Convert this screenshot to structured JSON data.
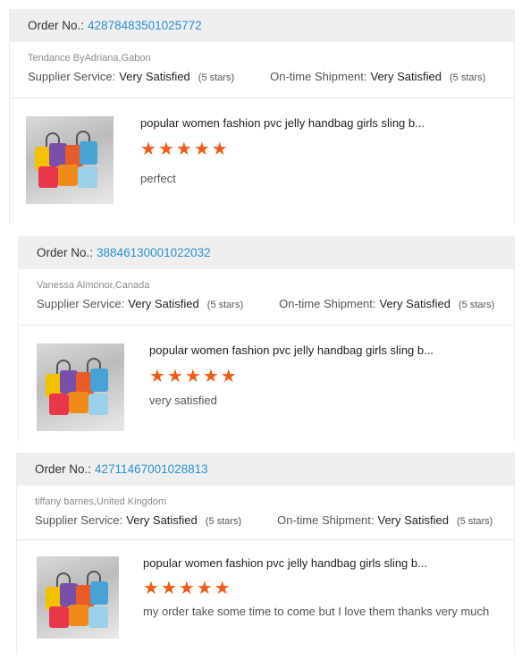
{
  "labels": {
    "order_prefix": "Order No.:",
    "supplier_service": "Supplier Service:",
    "on_time_shipment": "On-time Shipment:"
  },
  "reviews": [
    {
      "order_no": "42878483501025772",
      "buyer": "Tendance ByAdriana,Gabon",
      "supplier_value": "Very Satisfied",
      "supplier_stars": "(5 stars)",
      "shipment_value": "Very Satisfied",
      "shipment_stars": "(5 stars)",
      "product_title": "popular women fashion pvc jelly handbag girls sling b...",
      "rating": 5,
      "comment": "perfect"
    },
    {
      "order_no": "38846130001022032",
      "buyer": "Vanessa Almonor,Canada",
      "supplier_value": "Very Satisfied",
      "supplier_stars": "(5 stars)",
      "shipment_value": "Very Satisfied",
      "shipment_stars": "(5 stars)",
      "product_title": "popular women fashion pvc jelly handbag girls sling b...",
      "rating": 5,
      "comment": "very satisfied"
    },
    {
      "order_no": "42711467001028813",
      "buyer": "tiffany barnes,United Kingdom",
      "supplier_value": "Very Satisfied",
      "supplier_stars": "(5 stars)",
      "shipment_value": "Very Satisfied",
      "shipment_stars": "(5 stars)",
      "product_title": "popular women fashion pvc jelly handbag girls sling b...",
      "rating": 5,
      "comment": "my order take some time to come but I love them thanks very much"
    }
  ],
  "colors": {
    "order_number": "#2a8fd0",
    "star": "#f05a1a",
    "header_bg": "#efefef"
  }
}
